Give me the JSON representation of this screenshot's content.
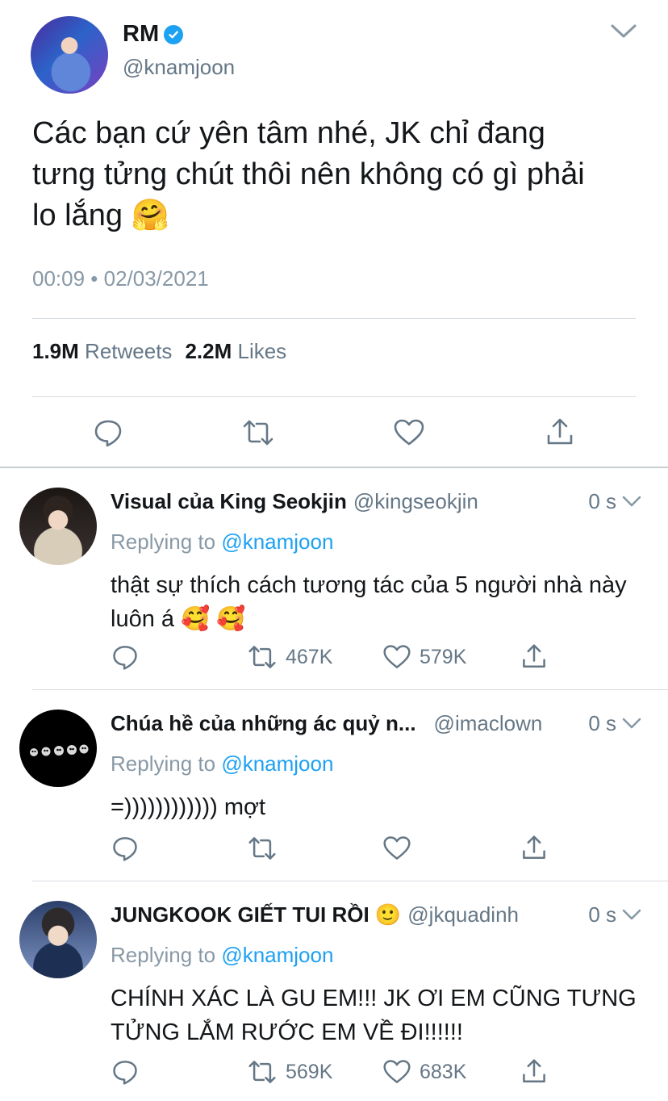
{
  "main_tweet": {
    "author_name": "RM",
    "author_handle": "@knamjoon",
    "text": "Các bạn cứ yên tâm nhé, JK chỉ đang tưng tửng chút thôi nên không có gì phải lo lắng 🤗",
    "timestamp": "00:09 • 02/03/2021",
    "retweets_count": "1.9M",
    "retweets_label": "Retweets",
    "likes_count": "2.2M",
    "likes_label": "Likes"
  },
  "replies": [
    {
      "name": "Visual của King Seokjin",
      "handle": "@kingseokjin",
      "time": "0 s",
      "replying_prefix": "Replying to ",
      "replying_handle": "@knamjoon",
      "text": "thật sự thích cách tương tác của 5 người nhà này luôn á 🥰 🥰",
      "retweets": "467K",
      "likes": "579K"
    },
    {
      "name": "Chúa hề của những ác quỷ n...",
      "handle": "@imaclown",
      "time": "0 s",
      "replying_prefix": "Replying to ",
      "replying_handle": "@knamjoon",
      "text": "=)))))))))))) mợt",
      "retweets": "",
      "likes": ""
    },
    {
      "name": "JUNGKOOK GIẾT TUI RỒI 🙂",
      "handle": "@jkquadinh",
      "time": "0 s",
      "replying_prefix": "Replying to ",
      "replying_handle": "@knamjoon",
      "text": "CHÍNH XÁC LÀ GU EM!!! JK ƠI EM CŨNG TƯNG TỬNG LẮM RƯỚC EM VỀ ĐI!!!!!!",
      "retweets": "569K",
      "likes": "683K"
    }
  ],
  "colors": {
    "link": "#1da1f2",
    "secondary_text": "#657786",
    "divider": "#d6dbe0"
  },
  "icons": [
    "chevron-down-icon",
    "verified-badge-icon",
    "reply-icon",
    "retweet-icon",
    "like-icon",
    "share-icon"
  ]
}
